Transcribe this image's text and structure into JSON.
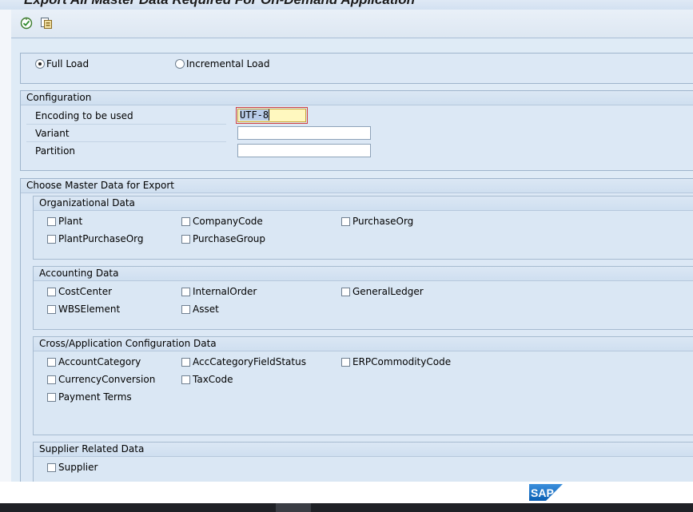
{
  "window": {
    "title": "Export All Master Data Required For On-Demand Application"
  },
  "toolbar": {
    "execute_icon": "execute-icon",
    "variant_icon": "get-variant-icon"
  },
  "load_type": {
    "options": [
      {
        "label": "Full Load",
        "selected": true
      },
      {
        "label": "Incremental Load",
        "selected": false
      }
    ]
  },
  "configuration": {
    "title": "Configuration",
    "encoding": {
      "label": "Encoding to be used",
      "value": "UTF-8"
    },
    "variant": {
      "label": "Variant",
      "value": ""
    },
    "partition": {
      "label": "Partition",
      "value": ""
    }
  },
  "master_data": {
    "title": "Choose Master Data for Export",
    "organizational": {
      "title": "Organizational Data",
      "items": [
        "Plant",
        "CompanyCode",
        "PurchaseOrg",
        "PlantPurchaseOrg",
        "PurchaseGroup"
      ]
    },
    "accounting": {
      "title": "Accounting Data",
      "items": [
        "CostCenter",
        "InternalOrder",
        "GeneralLedger",
        "WBSElement",
        "Asset"
      ]
    },
    "cross_app": {
      "title": "Cross/Application Configuration Data",
      "items": [
        "AccountCategory",
        "AccCategoryFieldStatus",
        "ERPCommodityCode",
        "CurrencyConversion",
        "TaxCode",
        "Payment Terms"
      ]
    },
    "supplier": {
      "title": "Supplier Related Data",
      "items": [
        "Supplier"
      ]
    }
  },
  "footer": {
    "logo_text": "SAP"
  },
  "colors": {
    "accent": "#2a6ebb",
    "focus_field": "#fff8bf"
  }
}
